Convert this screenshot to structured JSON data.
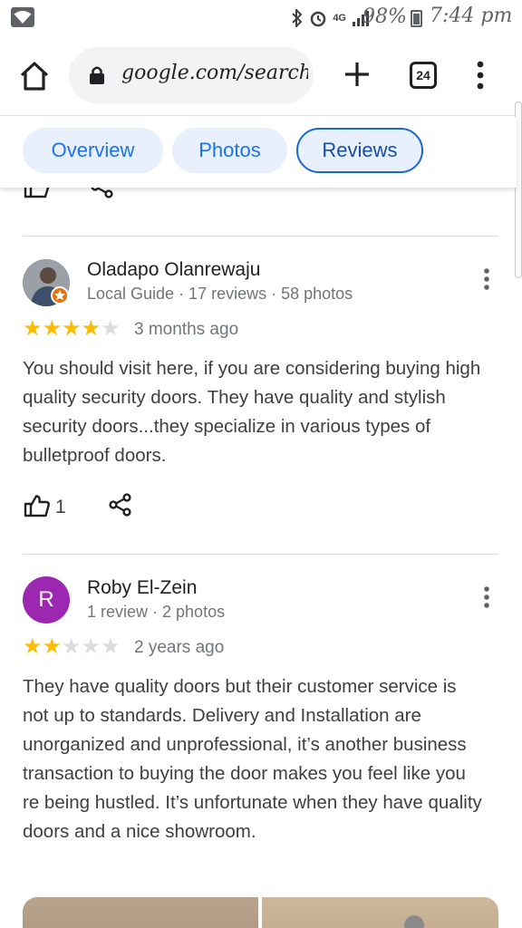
{
  "status_bar": {
    "network_label": "4G",
    "battery_text": "98%",
    "time": "7:44 pm"
  },
  "browser": {
    "url": "google.com/search?q",
    "tab_count": "24"
  },
  "chips": [
    {
      "label": "Overview"
    },
    {
      "label": "Photos"
    },
    {
      "label": "Reviews",
      "selected": true
    }
  ],
  "reviews": [
    {
      "name": "Oladapo Olanrewaju",
      "meta": "Local Guide · 17 reviews · 58 photos",
      "rating": 4,
      "date": "3 months ago",
      "text": "You should visit here, if you are considering buying high quality security doors. They have quality and stylish security doors...they specialize in various types of bulletproof doors.",
      "likes": "1"
    },
    {
      "name": "Roby El-Zein",
      "avatar_letter": "R",
      "meta": "1 review · 2 photos",
      "rating": 2,
      "date": "2 years ago",
      "text": "They have quality doors but their customer service is not up to standards. Delivery and Installation are unorganized and unprofessional, it’s another business transaction to buying the door makes you feel like you re being hustled. It’s unfortunate when they have quality doors and a nice showroom."
    }
  ],
  "colors": {
    "chip_bg": "#e8f0fe",
    "chip_text": "#1a73e8",
    "star_on": "#fbbc04",
    "star_off": "#dadce0",
    "avatar_r": "#9c27b0",
    "local_guide_badge": "#e8710a"
  },
  "icons": [
    "wifi-icon",
    "bluetooth-icon",
    "alarm-icon",
    "signal-icon",
    "battery-icon",
    "home-icon",
    "lock-icon",
    "plus-icon",
    "tabs-icon",
    "more-vert-icon",
    "thumb-up-icon",
    "share-icon"
  ]
}
